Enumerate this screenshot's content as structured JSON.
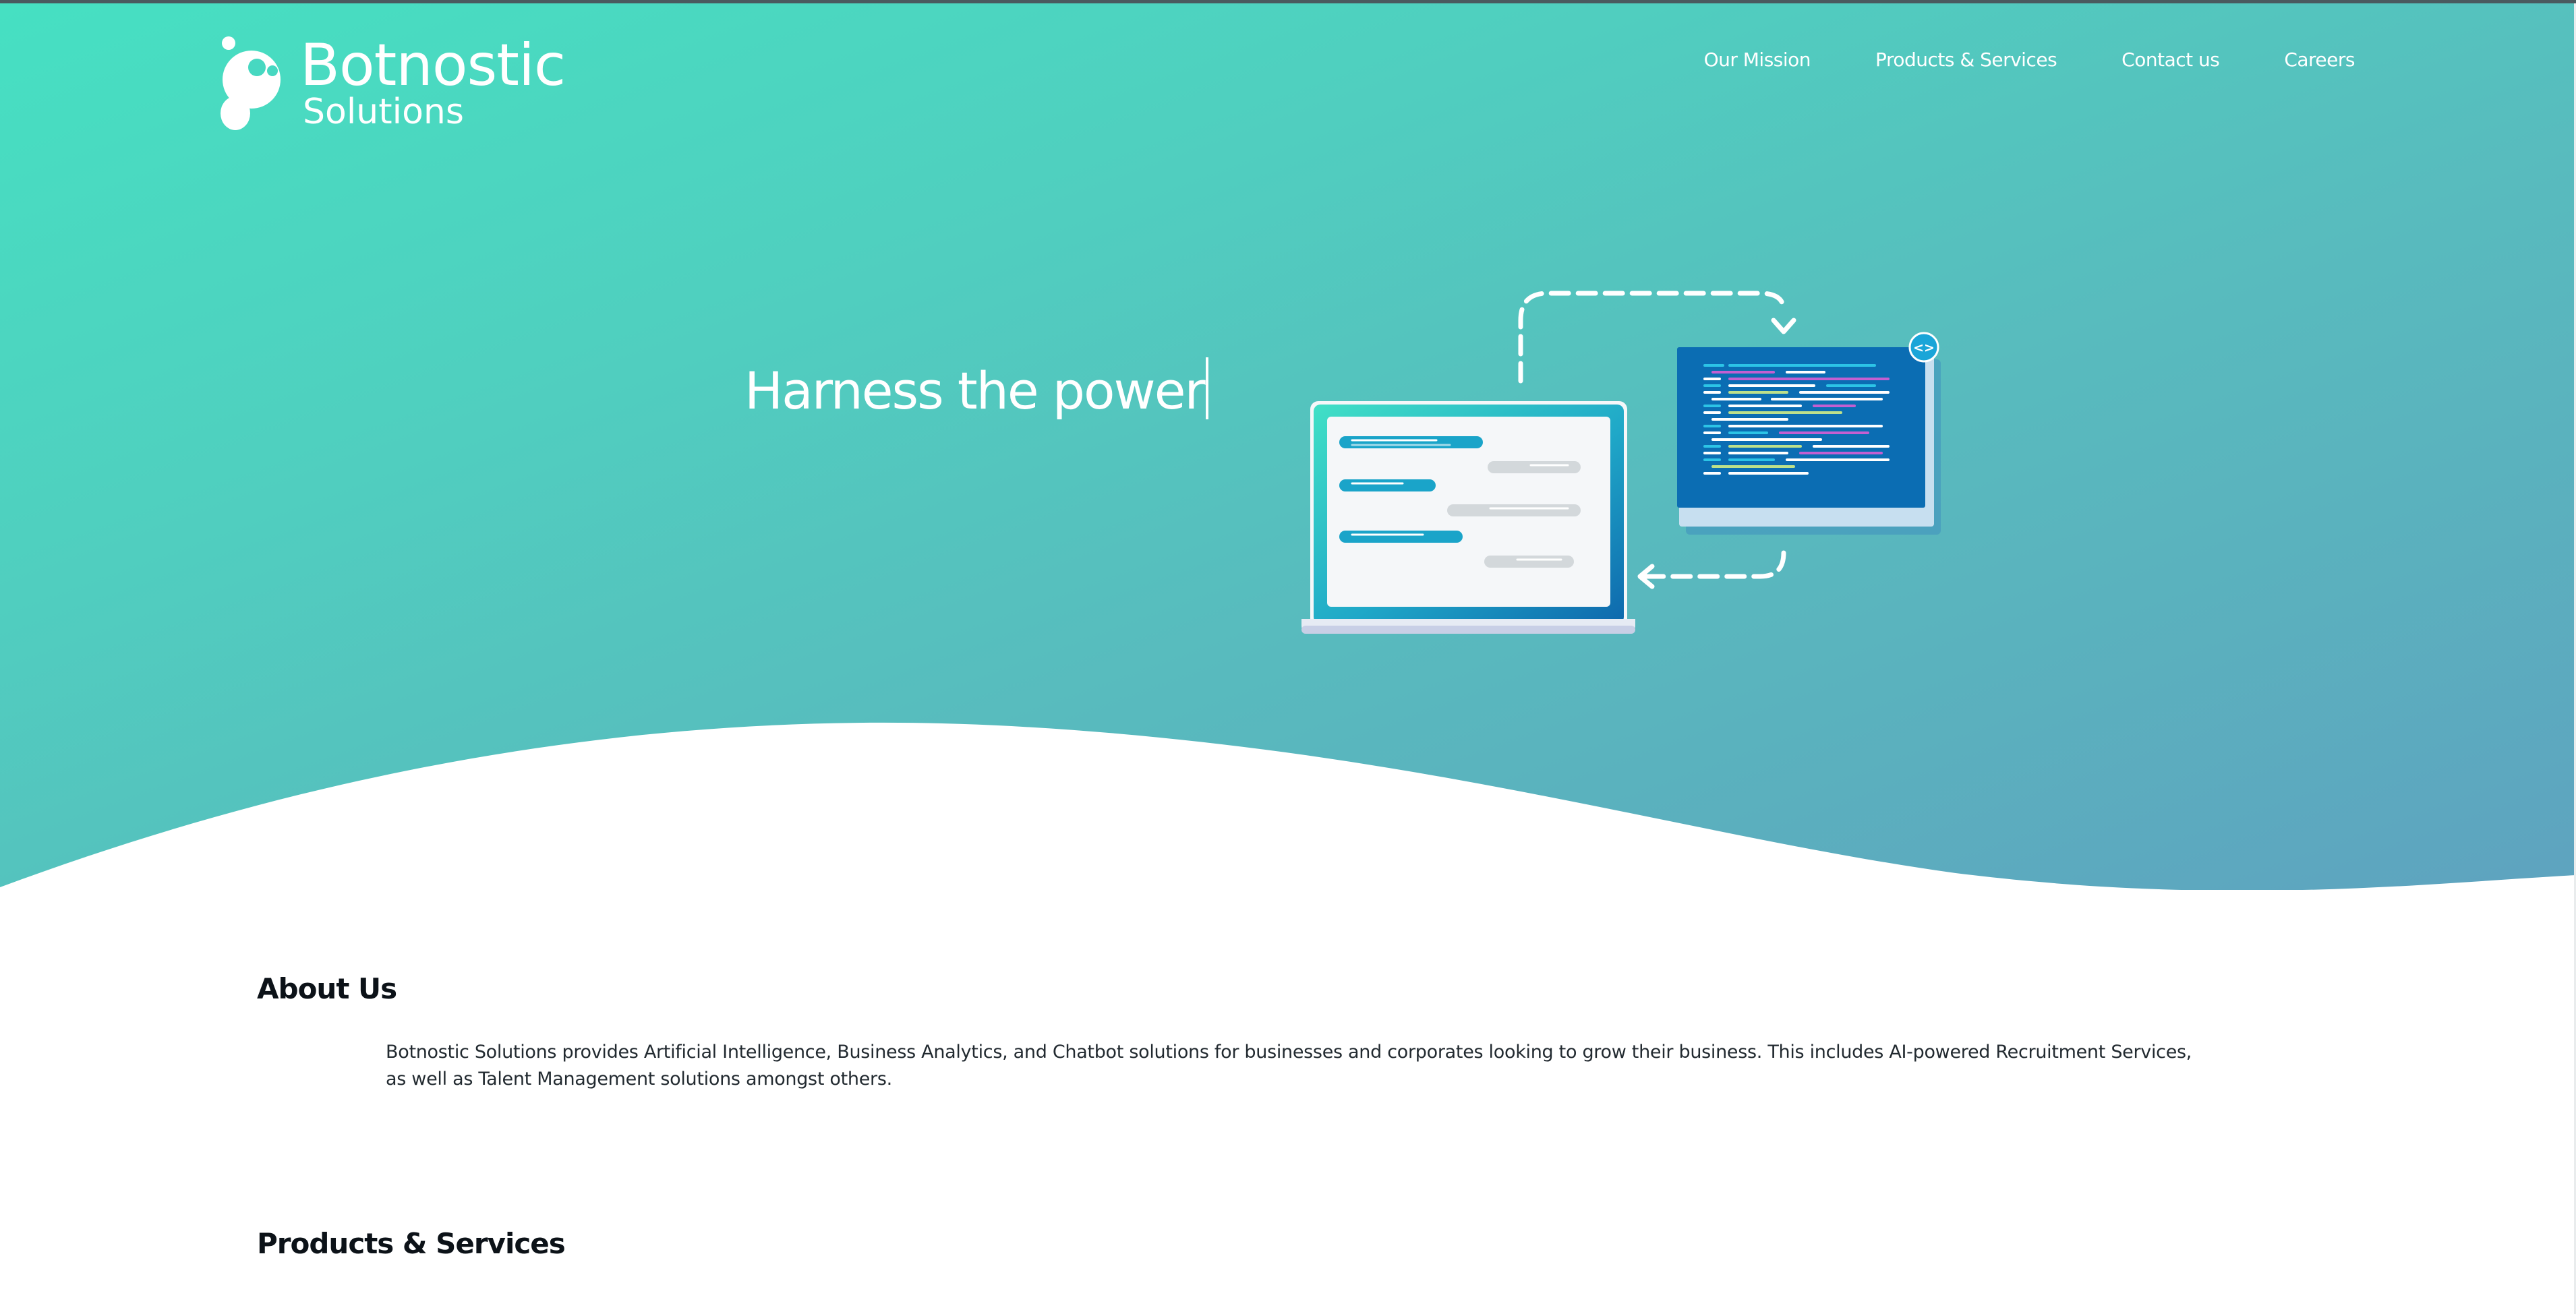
{
  "brand": {
    "name": "Botnostic",
    "tagline": "Solutions"
  },
  "nav": {
    "items": [
      "Our Mission",
      "Products & Services",
      "Contact us",
      "Careers"
    ]
  },
  "hero": {
    "headline": "Harness the power",
    "illustration_icons": [
      "laptop-chat-icon",
      "code-window-icon",
      "code-brackets-icon"
    ],
    "code_badge": "<>"
  },
  "about": {
    "title": "About Us",
    "text": "Botnostic Solutions provides Artificial Intelligence, Business Analytics, and Chatbot solutions for businesses and corporates looking to grow their business. This includes AI-powered Recruitment Services, as well as Talent Management solutions amongst others."
  },
  "products": {
    "title": "Products & Services"
  },
  "colors": {
    "hero_start": "#46e0c2",
    "hero_end": "#5ea3bf",
    "code_window": "#0b6db3",
    "text_dark": "#0c1218"
  }
}
